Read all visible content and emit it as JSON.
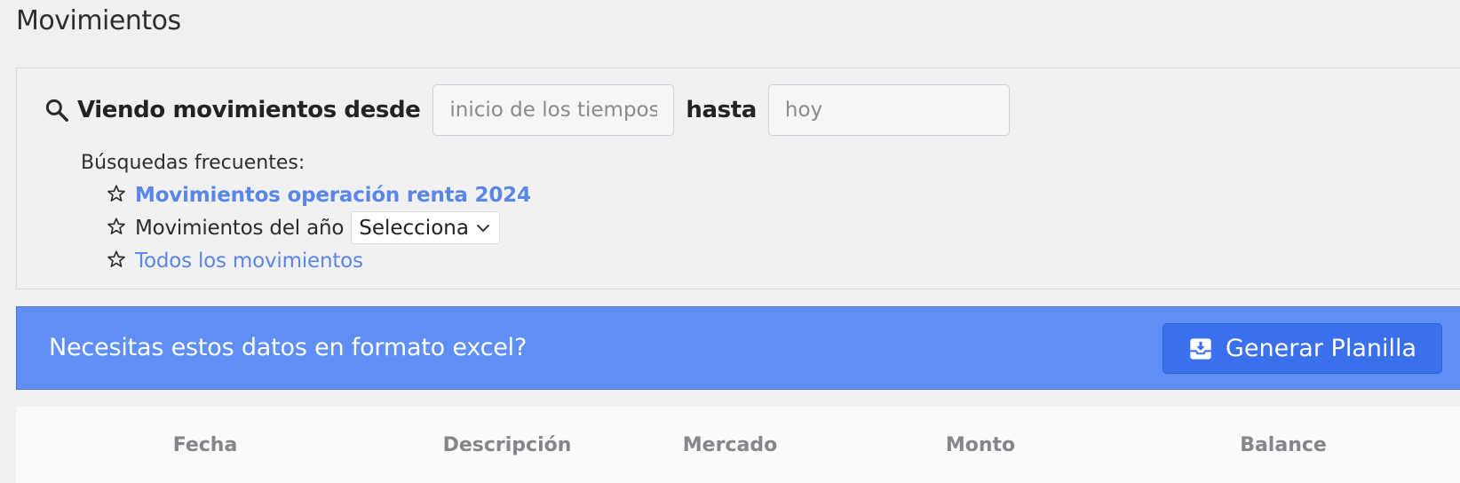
{
  "page": {
    "title": "Movimientos"
  },
  "search": {
    "label_from": "Viendo movimientos desde",
    "from_placeholder": "inicio de los tiempos",
    "label_to": "hasta",
    "to_placeholder": "hoy",
    "frequent_title": "Búsquedas frecuentes:",
    "items": [
      {
        "label": "Movimientos operación renta 2024",
        "type": "link-bold"
      },
      {
        "label": "Movimientos del año",
        "type": "select",
        "select_value": "Selecciona"
      },
      {
        "label": "Todos los movimientos",
        "type": "link"
      }
    ]
  },
  "excel_banner": {
    "text": "Necesitas estos datos en formato excel?",
    "button_label": "Generar Planilla"
  },
  "table": {
    "columns": [
      "Fecha",
      "Descripción",
      "Mercado",
      "Monto",
      "Balance"
    ]
  },
  "icons": {
    "search": "search-icon",
    "star": "star-outline-icon",
    "chevron": "chevron-down-icon",
    "download": "download-tray-icon"
  },
  "colors": {
    "background": "#f0f0f2",
    "link": "#5a86e6",
    "banner": "#5f8ff5",
    "button": "#3b70ec",
    "header_text": "#85858e"
  }
}
